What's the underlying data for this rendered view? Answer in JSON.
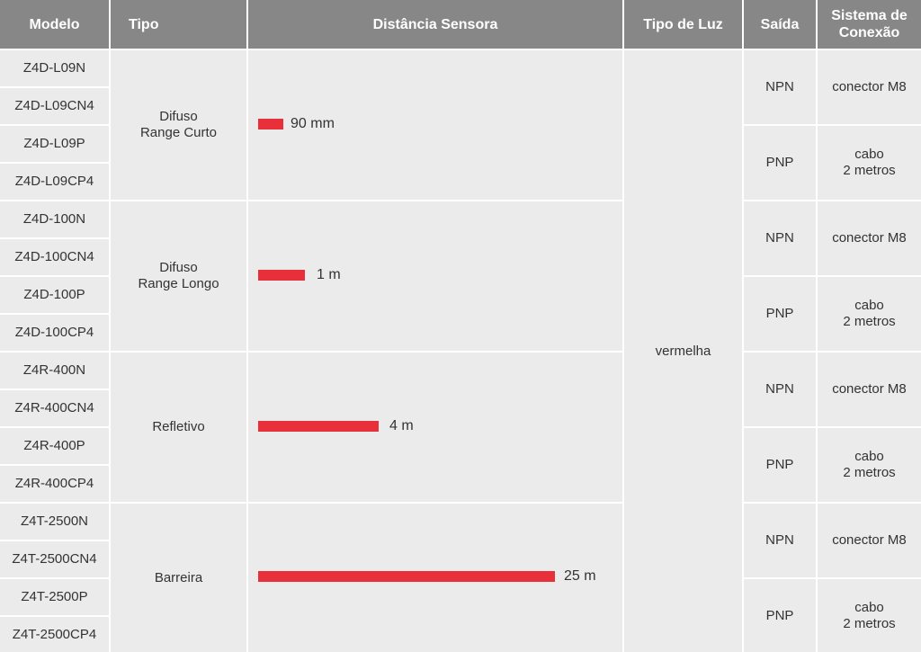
{
  "headers": {
    "modelo": "Modelo",
    "tipo": "Tipo",
    "distancia": "Distância Sensora",
    "tipo_luz": "Tipo de Luz",
    "saida": "Saída",
    "sistema_line1": "Sistema de",
    "sistema_line2": "Conexão"
  },
  "models": [
    "Z4D-L09N",
    "Z4D-L09CN4",
    "Z4D-L09P",
    "Z4D-L09CP4",
    "Z4D-100N",
    "Z4D-100CN4",
    "Z4D-100P",
    "Z4D-100CP4",
    "Z4R-400N",
    "Z4R-400CN4",
    "Z4R-400P",
    "Z4R-400CP4",
    "Z4T-2500N",
    "Z4T-2500CN4",
    "Z4T-2500P",
    "Z4T-2500CP4"
  ],
  "groups": [
    {
      "tipo_line1": "Difuso",
      "tipo_line2": "Range Curto",
      "distance": "90 mm",
      "distance_m": 0.09
    },
    {
      "tipo_line1": "Difuso",
      "tipo_line2": "Range Longo",
      "distance": "1 m",
      "distance_m": 1
    },
    {
      "tipo_line1": "Refletivo",
      "tipo_line2": "",
      "distance": "4 m",
      "distance_m": 4
    },
    {
      "tipo_line1": "Barreira",
      "tipo_line2": "",
      "distance": "25 m",
      "distance_m": 25
    }
  ],
  "tipo_luz": "vermelha",
  "outputs": [
    {
      "saida": "NPN",
      "conexao_line1": "conector M8",
      "conexao_line2": ""
    },
    {
      "saida": "PNP",
      "conexao_line1": "cabo",
      "conexao_line2": "2 metros"
    },
    {
      "saida": "NPN",
      "conexao_line1": "conector M8",
      "conexao_line2": ""
    },
    {
      "saida": "PNP",
      "conexao_line1": "cabo",
      "conexao_line2": "2 metros"
    },
    {
      "saida": "NPN",
      "conexao_line1": "conector M8",
      "conexao_line2": ""
    },
    {
      "saida": "PNP",
      "conexao_line1": "cabo",
      "conexao_line2": "2 metros"
    },
    {
      "saida": "NPN",
      "conexao_line1": "conector M8",
      "conexao_line2": ""
    },
    {
      "saida": "PNP",
      "conexao_line1": "cabo",
      "conexao_line2": "2 metros"
    }
  ],
  "colors": {
    "header_bg": "#878787",
    "cell_bg": "#ebebeb",
    "bar": "#e8303a"
  }
}
